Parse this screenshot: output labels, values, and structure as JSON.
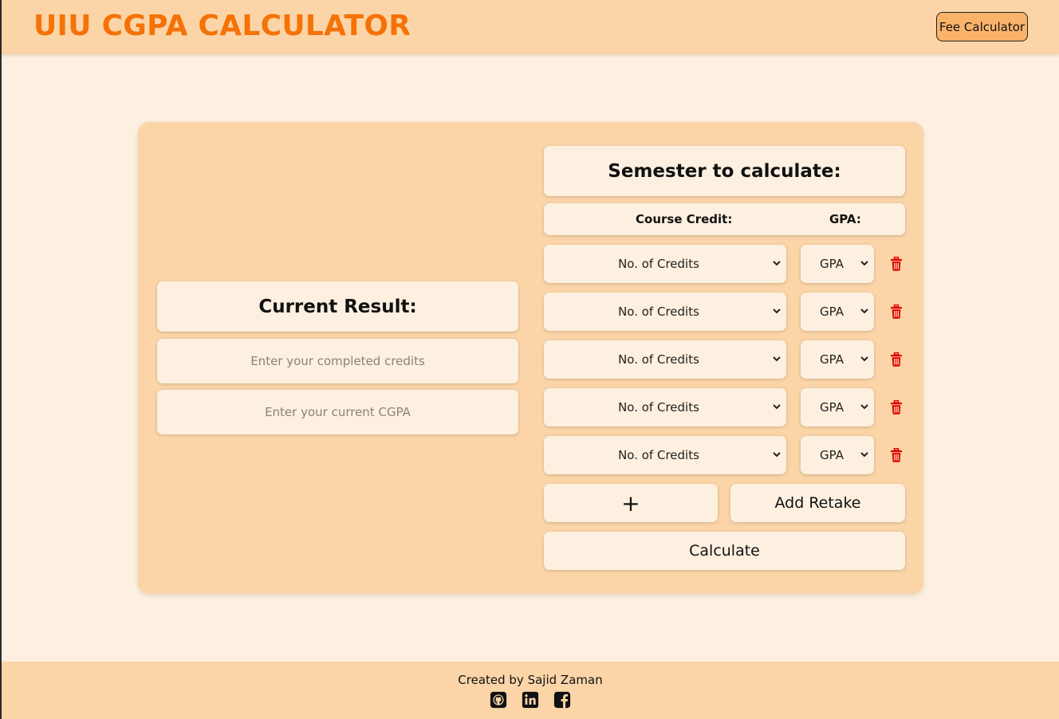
{
  "header": {
    "brand": "UIU CGPA CALCULATOR",
    "fee_button": "Fee Calculator"
  },
  "current": {
    "title": "Current Result:",
    "credits_placeholder": "Enter your completed credits",
    "cgpa_placeholder": "Enter your current CGPA"
  },
  "semester": {
    "title": "Semester to calculate:",
    "col_credit": "Course Credit:",
    "col_gpa": "GPA:",
    "rows": [
      {
        "credit": "No. of Credits",
        "gpa": "GPA"
      },
      {
        "credit": "No. of Credits",
        "gpa": "GPA"
      },
      {
        "credit": "No. of Credits",
        "gpa": "GPA"
      },
      {
        "credit": "No. of Credits",
        "gpa": "GPA"
      },
      {
        "credit": "No. of Credits",
        "gpa": "GPA"
      }
    ],
    "add_button": "+",
    "retake_button": "Add Retake",
    "calculate_button": "Calculate"
  },
  "footer": {
    "credit": "Created by Sajid Zaman",
    "icons": [
      "github-icon",
      "linkedin-icon",
      "facebook-icon"
    ]
  },
  "colors": {
    "accent": "#f57206",
    "panel": "#fbd5a8",
    "background": "#fdf0e0",
    "danger": "#e00000"
  }
}
